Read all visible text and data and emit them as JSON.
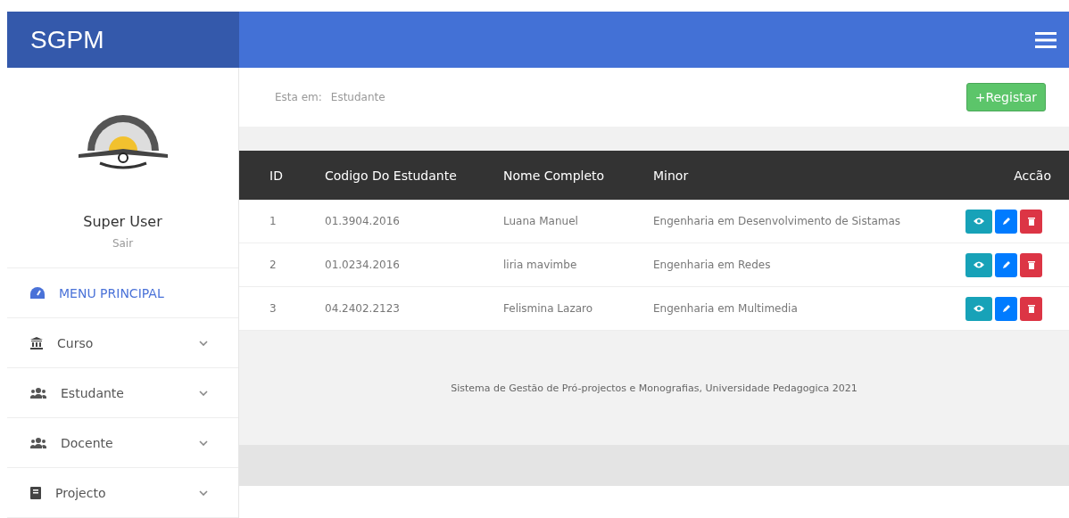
{
  "brand": "SGPM",
  "user": {
    "name": "Super User",
    "logout": "Sair"
  },
  "sidebar": {
    "items": [
      {
        "label": "MENU PRINCIPAL",
        "kind": "link",
        "selected": true
      },
      {
        "label": "Curso",
        "kind": "group",
        "selected": false
      },
      {
        "label": "Estudante",
        "kind": "group",
        "selected": false
      },
      {
        "label": "Docente",
        "kind": "group",
        "selected": false
      },
      {
        "label": "Projecto",
        "kind": "group",
        "selected": false
      }
    ]
  },
  "breadcrumb": {
    "prefix": "Esta em:",
    "current": "Estudante"
  },
  "register_button": {
    "icon": "+",
    "label": "Registar"
  },
  "table": {
    "columns": [
      "ID",
      "Codigo Do Estudante",
      "Nome Completo",
      "Minor",
      "Accão"
    ],
    "rows": [
      [
        "1",
        "01.3904.2016",
        "Luana Manuel",
        "Engenharia em Desenvolvimento de Sistamas"
      ],
      [
        "2",
        "01.0234.2016",
        "liria mavimbe",
        "Engenharia em Redes"
      ],
      [
        "3",
        "04.2402.2123",
        "Felismina Lazaro",
        "Engenharia em Multimedia"
      ]
    ]
  },
  "footer": "Sistema de Gestão de Pró-projectos e Monografias, Universidade Pedagogica 2021"
}
